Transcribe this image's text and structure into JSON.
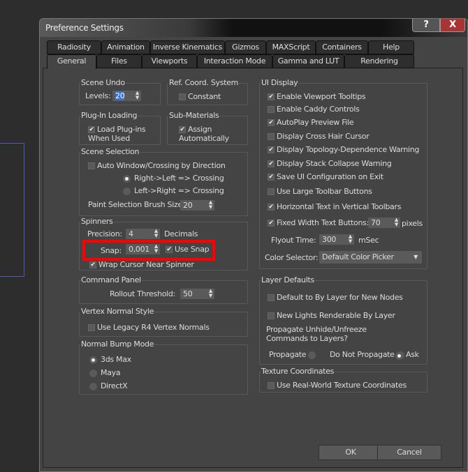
{
  "window": {
    "title": "Preference Settings",
    "help": "?",
    "close": "X"
  },
  "tabs_top": [
    "Radiosity",
    "Animation",
    "Inverse Kinematics",
    "Gizmos",
    "MAXScript",
    "Containers",
    "Help"
  ],
  "tabs_bottom": [
    "General",
    "Files",
    "Viewports",
    "Interaction Mode",
    "Gamma and LUT",
    "Rendering"
  ],
  "scene_undo": {
    "label": "Scene Undo",
    "levels_label": "Levels:",
    "levels": "20"
  },
  "ref_coord": {
    "label": "Ref. Coord. System",
    "constant": "Constant"
  },
  "plugin": {
    "label": "Plug-In Loading",
    "load": "Load Plug-ins When Used"
  },
  "submat": {
    "label": "Sub-Materials",
    "assign": "Assign Automatically"
  },
  "scene_sel": {
    "label": "Scene Selection",
    "auto": "Auto Window/Crossing by Direction",
    "rl": "Right->Left => Crossing",
    "lr": "Left->Right => Crossing",
    "brush_label": "Paint Selection Brush Size",
    "brush": "20"
  },
  "spinners": {
    "label": "Spinners",
    "precision_label": "Precision:",
    "precision": "4",
    "decimals": "Decimals",
    "snap_label": "Snap:",
    "snap": "0,001",
    "use_snap": "Use Snap",
    "wrap": "Wrap Cursor Near Spinner"
  },
  "command_panel": {
    "label": "Command Panel",
    "rollout_label": "Rollout Threshold:",
    "rollout": "50"
  },
  "vertex": {
    "label": "Vertex Normal Style",
    "legacy": "Use Legacy R4 Vertex Normals"
  },
  "bump": {
    "label": "Normal Bump Mode",
    "options": [
      "3ds Max",
      "Maya",
      "DirectX"
    ]
  },
  "ui_display": {
    "label": "UI Display",
    "items": [
      "Enable Viewport Tooltips",
      "Enable Caddy Controls",
      "AutoPlay Preview File",
      "Display Cross Hair Cursor",
      "Display Topology-Dependence Warning",
      "Display Stack Collapse Warning",
      "Save UI Configuration on Exit",
      "Use Large Toolbar Buttons",
      "Horizontal Text in Vertical Toolbars",
      "Fixed Width Text Buttons:"
    ],
    "fixed_width": "70",
    "pixels": "pixels",
    "flyout_label": "Flyout Time:",
    "flyout": "300",
    "msec": "mSec",
    "color_label": "Color Selector:",
    "color": "Default Color Picker"
  },
  "layer": {
    "label": "Layer Defaults",
    "default_by_layer": "Default to By Layer for New Nodes",
    "new_lights": "New Lights Renderable By Layer",
    "propagate_q": "Propagate Unhide/Unfreeze Commands to Layers?",
    "propagate": "Propagate",
    "no_propagate": "Do Not Propagate",
    "ask": "Ask"
  },
  "texture": {
    "label": "Texture Coordinates",
    "realworld": "Use Real-World Texture Coordinates"
  },
  "buttons": {
    "ok": "OK",
    "cancel": "Cancel"
  }
}
